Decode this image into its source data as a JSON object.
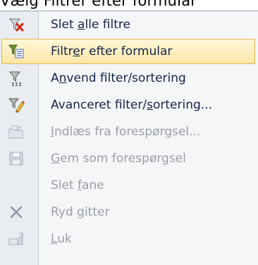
{
  "caption": "Vælg Filtrer efter formular",
  "menu": {
    "items": [
      {
        "pre": "Slet ",
        "key": "a",
        "post": "lle filtre",
        "icon": "clear-filter-icon",
        "enabled": true,
        "highlighted": false
      },
      {
        "pre": "Filtr",
        "key": "e",
        "post": "r efter formular",
        "icon": "filter-by-form-icon",
        "enabled": true,
        "highlighted": true
      },
      {
        "pre": "A",
        "key": "n",
        "post": "vend filter/sortering",
        "icon": "apply-filter-icon",
        "enabled": true,
        "highlighted": false
      },
      {
        "pre": "Avanceret filter/",
        "key": "s",
        "post": "ortering...",
        "icon": "advanced-filter-icon",
        "enabled": true,
        "highlighted": false
      },
      {
        "pre": "",
        "key": "I",
        "post": "ndlæs fra forespørgsel...",
        "icon": "load-from-query-icon",
        "enabled": false,
        "highlighted": false
      },
      {
        "pre": "",
        "key": "G",
        "post": "em som forespørgsel",
        "icon": "save-as-query-icon",
        "enabled": false,
        "highlighted": false
      },
      {
        "pre": "Slet ",
        "key": "f",
        "post": "ane",
        "icon": "",
        "enabled": false,
        "highlighted": false
      },
      {
        "pre": "Ryd ",
        "key": "g",
        "post": "itter",
        "icon": "clear-grid-icon",
        "enabled": false,
        "highlighted": false
      },
      {
        "pre": "",
        "key": "L",
        "post": "uk",
        "icon": "close-icon",
        "enabled": false,
        "highlighted": false
      }
    ]
  }
}
